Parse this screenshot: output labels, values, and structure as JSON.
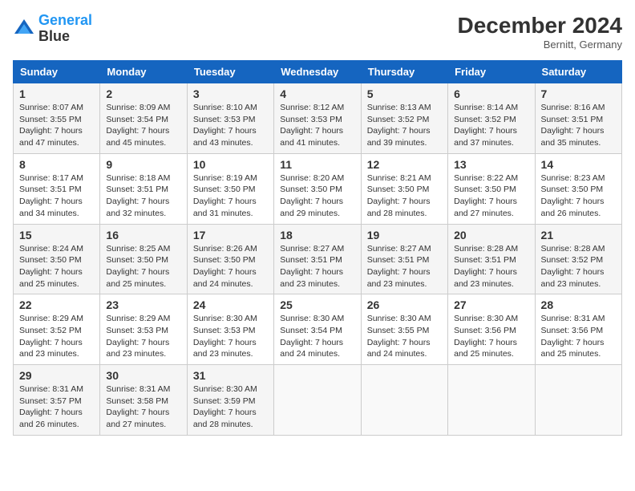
{
  "header": {
    "logo_line1": "General",
    "logo_line2": "Blue",
    "month_title": "December 2024",
    "location": "Bernitt, Germany"
  },
  "weekdays": [
    "Sunday",
    "Monday",
    "Tuesday",
    "Wednesday",
    "Thursday",
    "Friday",
    "Saturday"
  ],
  "weeks": [
    [
      {
        "day": "1",
        "info": "Sunrise: 8:07 AM\nSunset: 3:55 PM\nDaylight: 7 hours\nand 47 minutes."
      },
      {
        "day": "2",
        "info": "Sunrise: 8:09 AM\nSunset: 3:54 PM\nDaylight: 7 hours\nand 45 minutes."
      },
      {
        "day": "3",
        "info": "Sunrise: 8:10 AM\nSunset: 3:53 PM\nDaylight: 7 hours\nand 43 minutes."
      },
      {
        "day": "4",
        "info": "Sunrise: 8:12 AM\nSunset: 3:53 PM\nDaylight: 7 hours\nand 41 minutes."
      },
      {
        "day": "5",
        "info": "Sunrise: 8:13 AM\nSunset: 3:52 PM\nDaylight: 7 hours\nand 39 minutes."
      },
      {
        "day": "6",
        "info": "Sunrise: 8:14 AM\nSunset: 3:52 PM\nDaylight: 7 hours\nand 37 minutes."
      },
      {
        "day": "7",
        "info": "Sunrise: 8:16 AM\nSunset: 3:51 PM\nDaylight: 7 hours\nand 35 minutes."
      }
    ],
    [
      {
        "day": "8",
        "info": "Sunrise: 8:17 AM\nSunset: 3:51 PM\nDaylight: 7 hours\nand 34 minutes."
      },
      {
        "day": "9",
        "info": "Sunrise: 8:18 AM\nSunset: 3:51 PM\nDaylight: 7 hours\nand 32 minutes."
      },
      {
        "day": "10",
        "info": "Sunrise: 8:19 AM\nSunset: 3:50 PM\nDaylight: 7 hours\nand 31 minutes."
      },
      {
        "day": "11",
        "info": "Sunrise: 8:20 AM\nSunset: 3:50 PM\nDaylight: 7 hours\nand 29 minutes."
      },
      {
        "day": "12",
        "info": "Sunrise: 8:21 AM\nSunset: 3:50 PM\nDaylight: 7 hours\nand 28 minutes."
      },
      {
        "day": "13",
        "info": "Sunrise: 8:22 AM\nSunset: 3:50 PM\nDaylight: 7 hours\nand 27 minutes."
      },
      {
        "day": "14",
        "info": "Sunrise: 8:23 AM\nSunset: 3:50 PM\nDaylight: 7 hours\nand 26 minutes."
      }
    ],
    [
      {
        "day": "15",
        "info": "Sunrise: 8:24 AM\nSunset: 3:50 PM\nDaylight: 7 hours\nand 25 minutes."
      },
      {
        "day": "16",
        "info": "Sunrise: 8:25 AM\nSunset: 3:50 PM\nDaylight: 7 hours\nand 25 minutes."
      },
      {
        "day": "17",
        "info": "Sunrise: 8:26 AM\nSunset: 3:50 PM\nDaylight: 7 hours\nand 24 minutes."
      },
      {
        "day": "18",
        "info": "Sunrise: 8:27 AM\nSunset: 3:51 PM\nDaylight: 7 hours\nand 23 minutes."
      },
      {
        "day": "19",
        "info": "Sunrise: 8:27 AM\nSunset: 3:51 PM\nDaylight: 7 hours\nand 23 minutes."
      },
      {
        "day": "20",
        "info": "Sunrise: 8:28 AM\nSunset: 3:51 PM\nDaylight: 7 hours\nand 23 minutes."
      },
      {
        "day": "21",
        "info": "Sunrise: 8:28 AM\nSunset: 3:52 PM\nDaylight: 7 hours\nand 23 minutes."
      }
    ],
    [
      {
        "day": "22",
        "info": "Sunrise: 8:29 AM\nSunset: 3:52 PM\nDaylight: 7 hours\nand 23 minutes."
      },
      {
        "day": "23",
        "info": "Sunrise: 8:29 AM\nSunset: 3:53 PM\nDaylight: 7 hours\nand 23 minutes."
      },
      {
        "day": "24",
        "info": "Sunrise: 8:30 AM\nSunset: 3:53 PM\nDaylight: 7 hours\nand 23 minutes."
      },
      {
        "day": "25",
        "info": "Sunrise: 8:30 AM\nSunset: 3:54 PM\nDaylight: 7 hours\nand 24 minutes."
      },
      {
        "day": "26",
        "info": "Sunrise: 8:30 AM\nSunset: 3:55 PM\nDaylight: 7 hours\nand 24 minutes."
      },
      {
        "day": "27",
        "info": "Sunrise: 8:30 AM\nSunset: 3:56 PM\nDaylight: 7 hours\nand 25 minutes."
      },
      {
        "day": "28",
        "info": "Sunrise: 8:31 AM\nSunset: 3:56 PM\nDaylight: 7 hours\nand 25 minutes."
      }
    ],
    [
      {
        "day": "29",
        "info": "Sunrise: 8:31 AM\nSunset: 3:57 PM\nDaylight: 7 hours\nand 26 minutes."
      },
      {
        "day": "30",
        "info": "Sunrise: 8:31 AM\nSunset: 3:58 PM\nDaylight: 7 hours\nand 27 minutes."
      },
      {
        "day": "31",
        "info": "Sunrise: 8:30 AM\nSunset: 3:59 PM\nDaylight: 7 hours\nand 28 minutes."
      },
      {
        "day": "",
        "info": ""
      },
      {
        "day": "",
        "info": ""
      },
      {
        "day": "",
        "info": ""
      },
      {
        "day": "",
        "info": ""
      }
    ]
  ]
}
